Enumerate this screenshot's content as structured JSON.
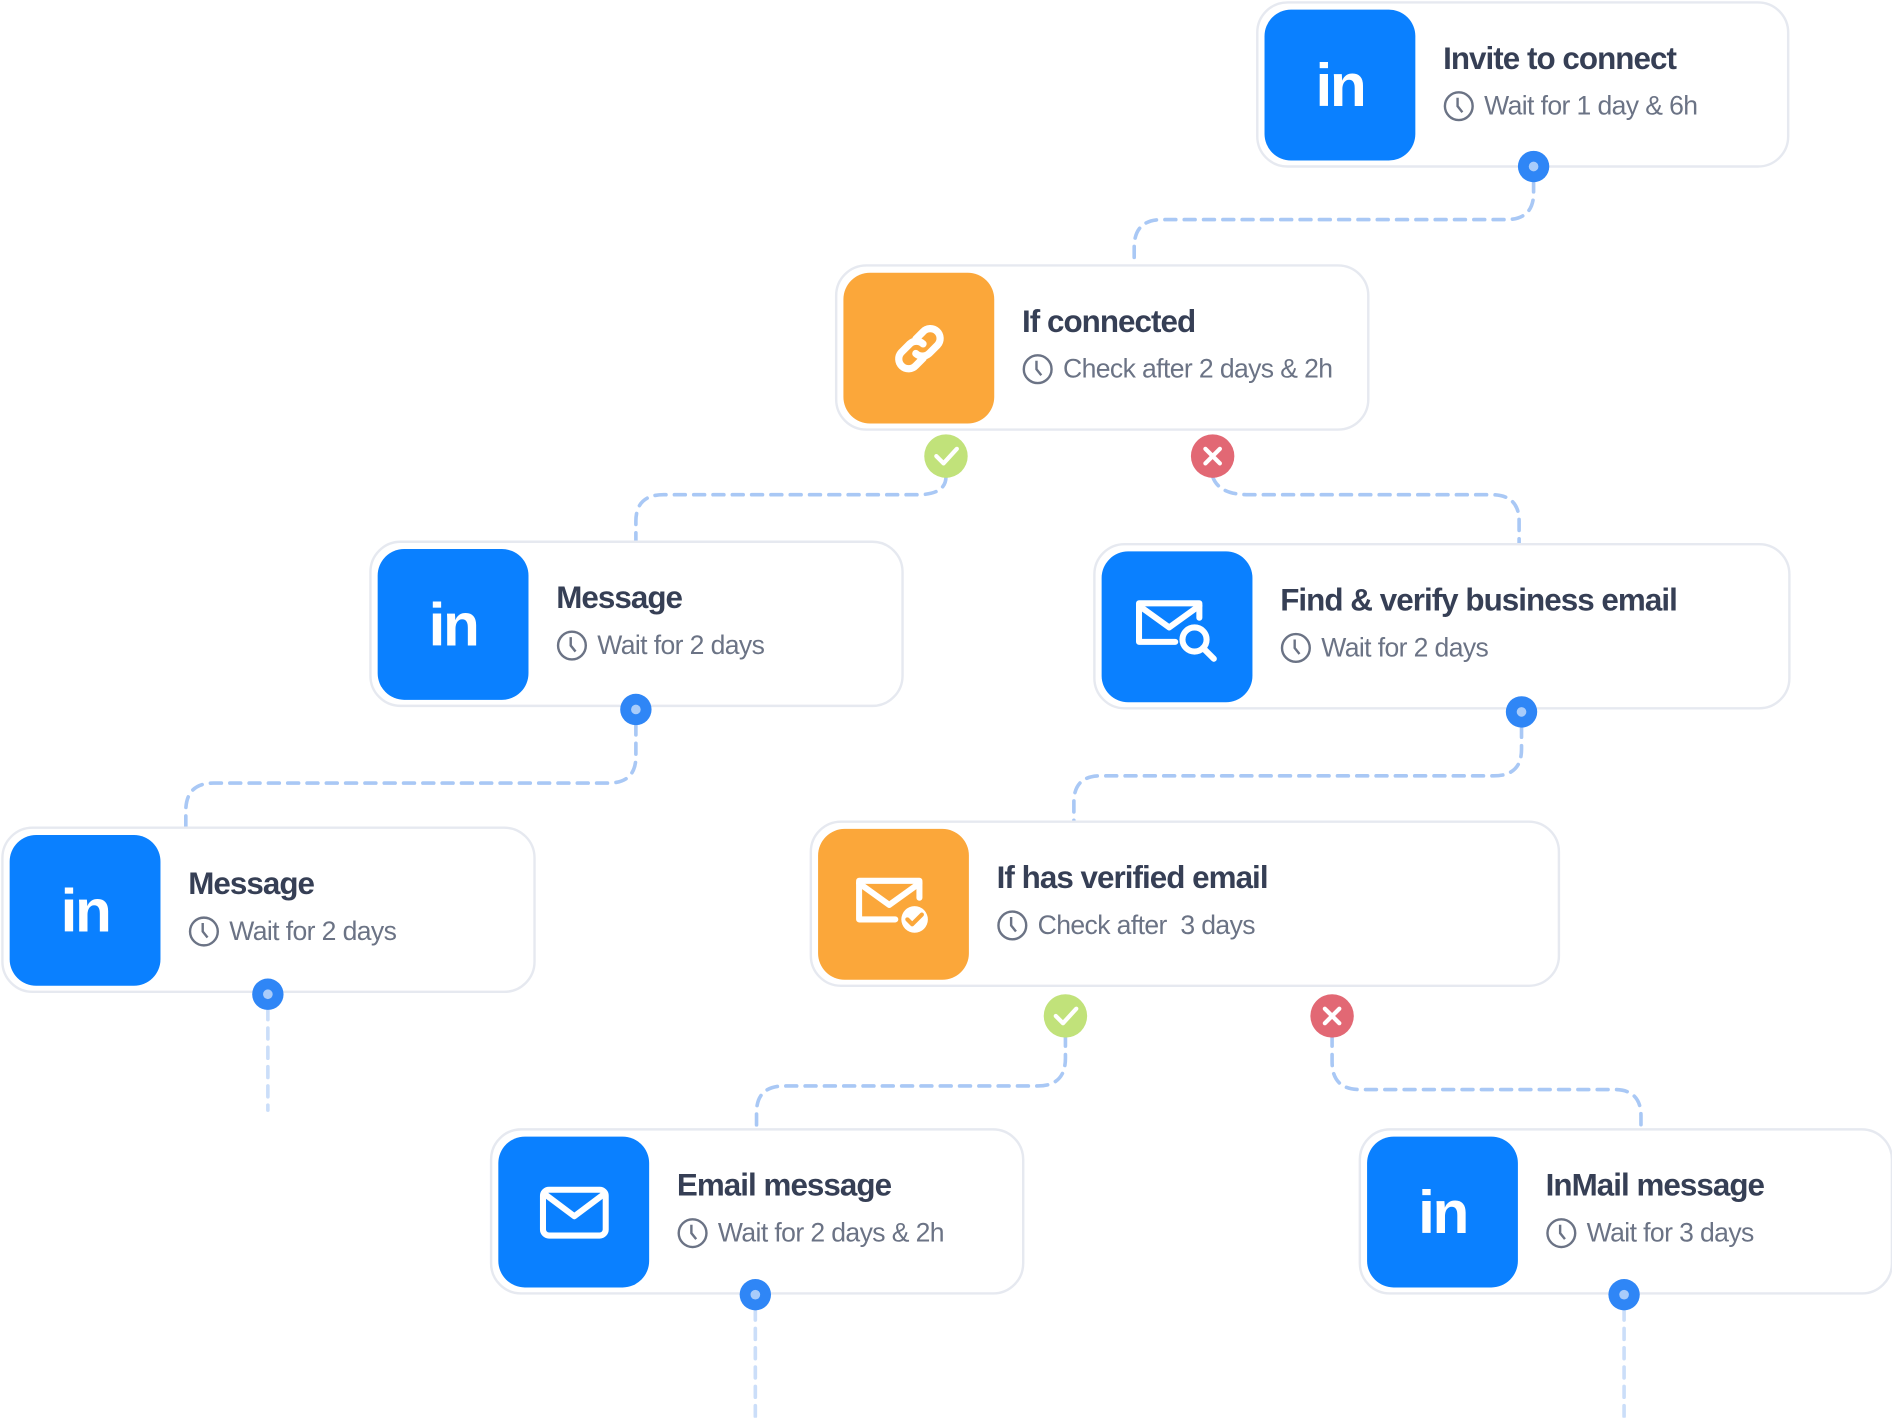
{
  "colors": {
    "linkedin": "#0a80ff",
    "condition": "#fba73a",
    "yes": "#c1e27a",
    "no": "#e26874",
    "connector": "#a9c8f5",
    "port": "#2f86f6"
  },
  "nodes": [
    {
      "title": "Invite to connect",
      "subtitle": "Wait for 1 day & 6h",
      "icon": "linkedin-icon",
      "icon_text": "in"
    },
    {
      "title": "If connected",
      "subtitle": "Check after 2 days & 2h",
      "icon": "link-icon"
    },
    {
      "title": "Message",
      "subtitle": "Wait for 2 days",
      "icon": "linkedin-icon",
      "icon_text": "in"
    },
    {
      "title": "Find & verify business email",
      "subtitle": "Wait for 2 days",
      "icon": "email-search-icon"
    },
    {
      "title": "Message",
      "subtitle": "Wait for 2 days",
      "icon": "linkedin-icon",
      "icon_text": "in"
    },
    {
      "title": "If has verified email",
      "subtitle": "Check after  3 days",
      "icon": "email-verified-icon"
    },
    {
      "title": "Email message",
      "subtitle": "Wait for 2 days & 2h",
      "icon": "envelope-icon"
    },
    {
      "title": "InMail message",
      "subtitle": "Wait for 3 days",
      "icon": "linkedin-icon",
      "icon_text": "in"
    }
  ]
}
